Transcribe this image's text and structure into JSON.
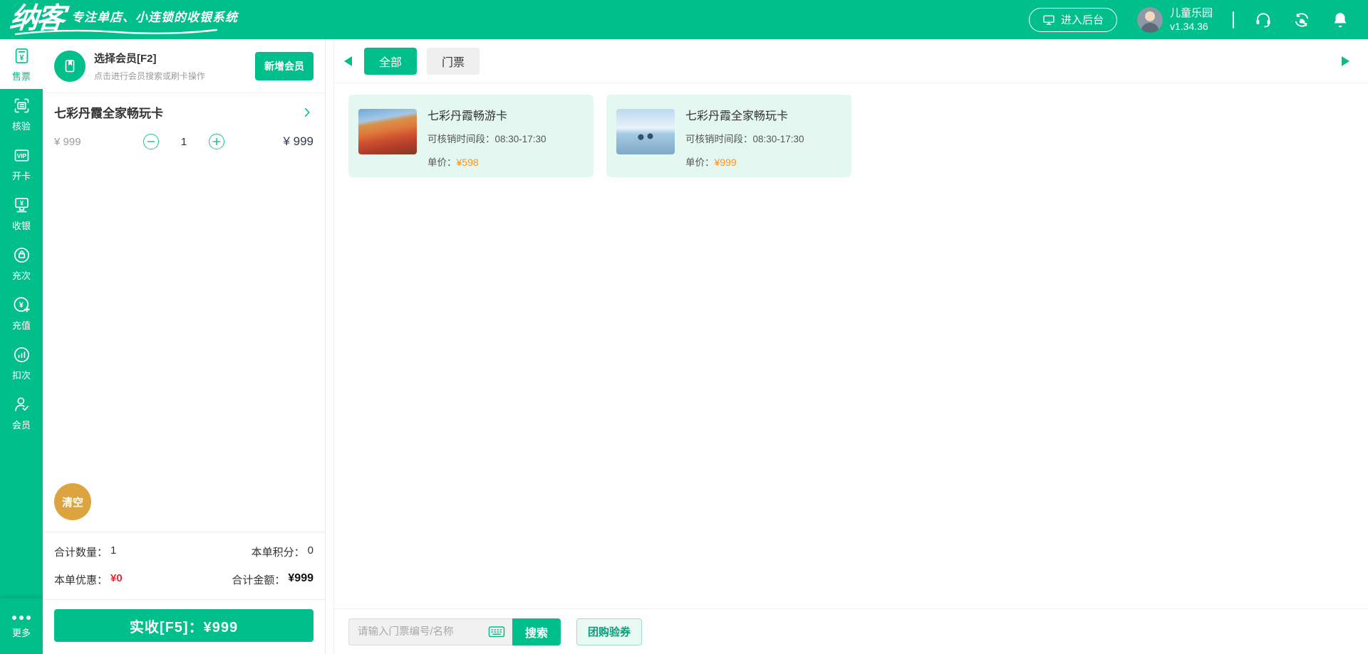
{
  "colors": {
    "accent_green": "#00bf8a",
    "clear_gold": "#dda33e",
    "danger_red": "#f5222d",
    "price_orange": "#ff9226",
    "card_mint": "#e5f7f1"
  },
  "icons": {
    "yen": "¥"
  },
  "header": {
    "logo": "纳客",
    "tagline": "专注单店、小连锁的收银系统",
    "backstage_button": "进入后台",
    "store_name": "儿童乐园",
    "version": "v1.34.36"
  },
  "sidebar": {
    "items": [
      {
        "label": "售票"
      },
      {
        "label": "核验"
      },
      {
        "label": "开卡",
        "icon_text": "VIP"
      },
      {
        "label": "收银"
      },
      {
        "label": "充次"
      },
      {
        "label": "充值"
      },
      {
        "label": "扣次"
      },
      {
        "label": "会员"
      }
    ],
    "more_label": "更多"
  },
  "member": {
    "title": "选择会员[F2]",
    "subtitle": "点击进行会员搜索或刷卡操作",
    "add_button": "新增会员"
  },
  "cart": {
    "item": {
      "name": "七彩丹霞全家畅玩卡",
      "unit_price": "¥ 999",
      "qty": "1",
      "line_total": "¥ 999"
    },
    "clear_button": "清空",
    "summary": {
      "qty_label": "合计数量：",
      "qty_value": "1",
      "points_label": "本单积分：",
      "points_value": "0",
      "discount_label": "本单优惠：",
      "discount_value": "¥0",
      "total_label": "合计金额：",
      "total_value": "¥999"
    },
    "checkout_button": "实收[F5]：¥999"
  },
  "catalog": {
    "tabs": [
      {
        "label": "全部"
      },
      {
        "label": "门票"
      }
    ],
    "products": [
      {
        "name": "七彩丹霞畅游卡",
        "time_label": "可核销时间段：",
        "time": "08:30-17:30",
        "price_label": "单价：",
        "price": "¥598"
      },
      {
        "name": "七彩丹霞全家畅玩卡",
        "time_label": "可核销时间段：",
        "time": "08:30-17:30",
        "price_label": "单价：",
        "price": "¥999"
      }
    ],
    "search": {
      "placeholder": "请输入门票编号/名称",
      "search_button": "搜索",
      "groupon_button": "团购验券"
    }
  }
}
